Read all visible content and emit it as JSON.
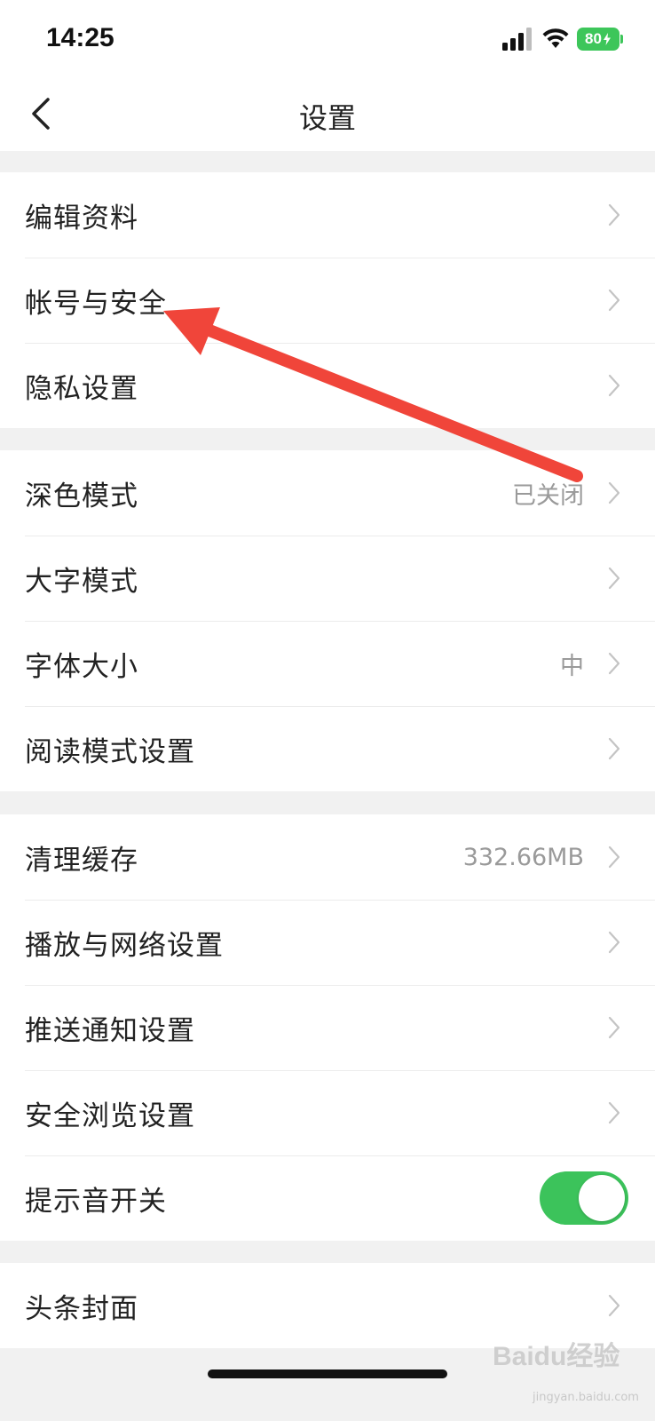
{
  "status_bar": {
    "time": "14:25",
    "battery": "80",
    "battery_color": "#3dc65a"
  },
  "nav": {
    "title": "设置",
    "back_icon": "chevron-left-icon"
  },
  "groups": [
    {
      "items": [
        {
          "label": "编辑资料",
          "value": ""
        },
        {
          "label": "帐号与安全",
          "value": ""
        },
        {
          "label": "隐私设置",
          "value": ""
        }
      ]
    },
    {
      "items": [
        {
          "label": "深色模式",
          "value": "已关闭"
        },
        {
          "label": "大字模式",
          "value": ""
        },
        {
          "label": "字体大小",
          "value": "中"
        },
        {
          "label": "阅读模式设置",
          "value": ""
        }
      ]
    },
    {
      "items": [
        {
          "label": "清理缓存",
          "value": "332.66MB"
        },
        {
          "label": "播放与网络设置",
          "value": ""
        },
        {
          "label": "推送通知设置",
          "value": ""
        },
        {
          "label": "安全浏览设置",
          "value": ""
        },
        {
          "label": "提示音开关",
          "toggle_on": true
        }
      ]
    },
    {
      "items": [
        {
          "label": "头条封面",
          "value": ""
        }
      ]
    }
  ],
  "toggle_color": "#3cc35b",
  "annotation_color": "#f0453a",
  "watermark": {
    "text": "Baidu经验",
    "sub": "jingyan.baidu.com"
  }
}
